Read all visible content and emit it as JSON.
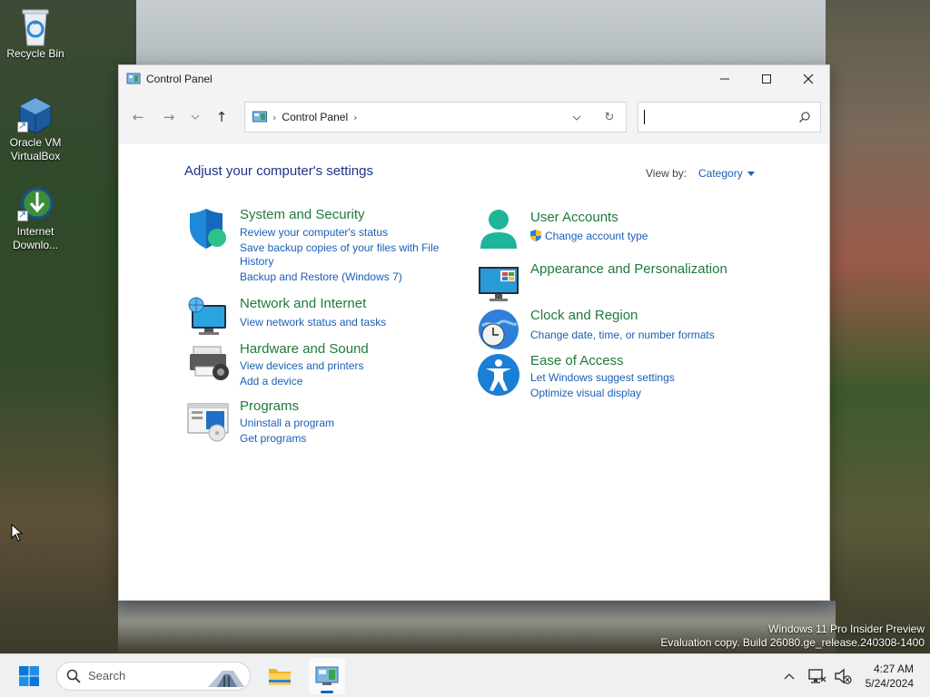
{
  "desktop": {
    "icons": [
      {
        "label": "Recycle Bin"
      },
      {
        "label": "Oracle VM\nVirtualBox"
      },
      {
        "label": "Internet\nDownlo..."
      }
    ],
    "watermark": {
      "line1": "Windows 11 Pro Insider Preview",
      "line2": "Evaluation copy. Build 26080.ge_release.240308-1400"
    }
  },
  "window": {
    "title": "Control Panel",
    "address": {
      "crumb": "Control Panel"
    },
    "search_placeholder": "",
    "heading": "Adjust your computer's settings",
    "view_by_label": "View by:",
    "view_by_value": "Category",
    "categories": {
      "system": {
        "title": "System and Security",
        "links": [
          "Review your computer's status",
          "Save backup copies of your files with File",
          "History",
          "Backup and Restore (Windows 7)"
        ]
      },
      "network": {
        "title": "Network and Internet",
        "links": [
          "View network status and tasks"
        ]
      },
      "hardware": {
        "title": "Hardware and Sound",
        "links": [
          "View devices and printers",
          "Add a device"
        ]
      },
      "programs": {
        "title": "Programs",
        "links": [
          "Uninstall a program",
          "Get programs"
        ]
      },
      "users": {
        "title": "User Accounts",
        "links": [
          "Change account type"
        ]
      },
      "appearance": {
        "title": "Appearance and Personalization",
        "links": []
      },
      "clock": {
        "title": "Clock and Region",
        "links": [
          "Change date, time, or number formats"
        ]
      },
      "ease": {
        "title": "Ease of Access",
        "links": [
          "Let Windows suggest settings",
          "Optimize visual display"
        ]
      }
    }
  },
  "taskbar": {
    "search_label": "Search",
    "time": "4:27 AM",
    "date": "5/24/2024"
  },
  "colors": {
    "accent": "#0067c0",
    "link": "#1a5fb4",
    "category_title": "#1f7a3a",
    "heading": "#1e3287"
  }
}
